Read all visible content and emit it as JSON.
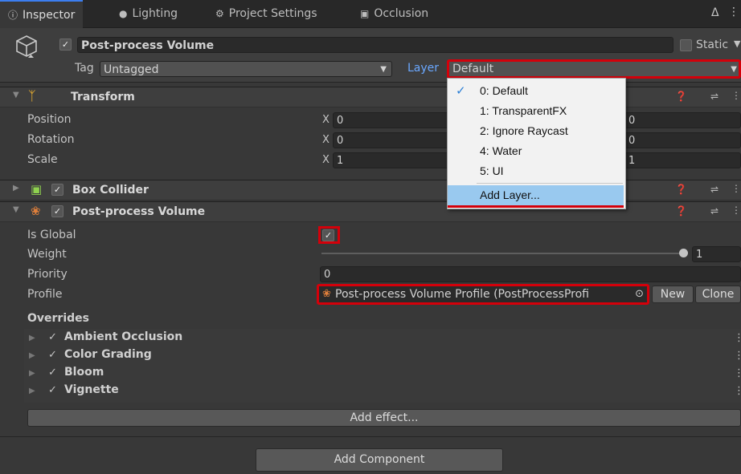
{
  "tabs": [
    {
      "label": "Inspector",
      "icon": "info-icon",
      "active": true
    },
    {
      "label": "Lighting",
      "icon": "bulb-icon",
      "active": false
    },
    {
      "label": "Project Settings",
      "icon": "gear-icon",
      "active": false
    },
    {
      "label": "Occlusion",
      "icon": "occlusion-icon",
      "active": false
    }
  ],
  "header": {
    "object_name": "Post-process Volume",
    "static_label": "Static",
    "tag_label": "Tag",
    "tag_value": "Untagged",
    "layer_label": "Layer",
    "layer_value": "Default"
  },
  "layer_dropdown": {
    "options": [
      "0: Default",
      "1: TransparentFX",
      "2: Ignore Raycast",
      "4: Water",
      "5: UI",
      "Add Layer..."
    ],
    "selected": "0: Default",
    "highlighted": "Add Layer..."
  },
  "transform": {
    "title": "Transform",
    "rows": [
      {
        "label": "Position",
        "axis": "X",
        "x": "0",
        "y_partial": "0"
      },
      {
        "label": "Rotation",
        "axis": "X",
        "x": "0",
        "y_partial": "0"
      },
      {
        "label": "Scale",
        "axis": "X",
        "x": "1",
        "y_partial": "1"
      }
    ]
  },
  "box_collider": {
    "title": "Box Collider"
  },
  "ppvolume": {
    "title": "Post-process Volume",
    "is_global_label": "Is Global",
    "weight_label": "Weight",
    "weight_value": "1",
    "weight_fraction": 1.0,
    "priority_label": "Priority",
    "priority_value": "0",
    "profile_label": "Profile",
    "profile_value": "Post-process Volume Profile (PostProcessProfi",
    "new_label": "New",
    "clone_label": "Clone",
    "overrides_label": "Overrides",
    "overrides": [
      "Ambient Occlusion",
      "Color Grading",
      "Bloom",
      "Vignette"
    ],
    "add_effect_label": "Add effect..."
  },
  "add_component_label": "Add Component",
  "colors": {
    "accent": "#3c7ef0",
    "highlight": "#d4000a",
    "menu_hover": "#99c9ef"
  }
}
